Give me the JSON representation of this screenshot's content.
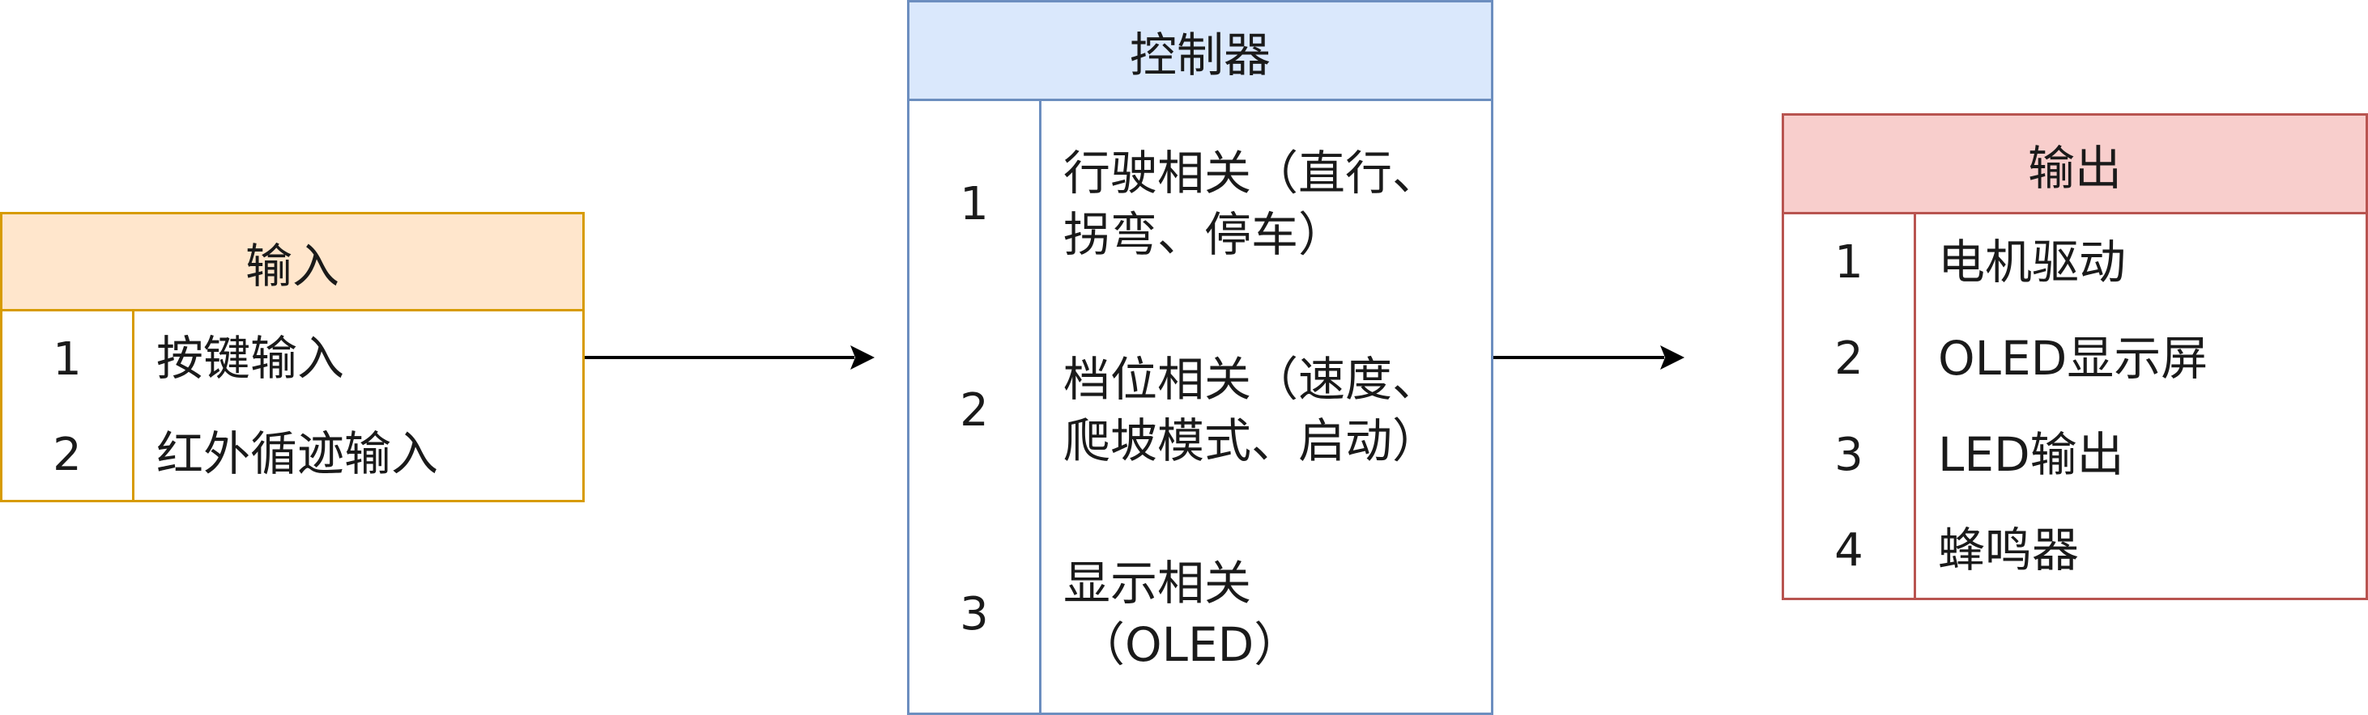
{
  "input": {
    "title": "输入",
    "items": [
      {
        "num": "1",
        "text": "按键输入"
      },
      {
        "num": "2",
        "text": "红外循迹输入"
      }
    ]
  },
  "controller": {
    "title": "控制器",
    "items": [
      {
        "num": "1",
        "line1": "行驶相关（直行、",
        "line2": "拐弯、停车）"
      },
      {
        "num": "2",
        "line1": "档位相关（速度、",
        "line2": "爬坡模式、启动）"
      },
      {
        "num": "3",
        "line1": "显示相关",
        "line2": "（OLED）"
      }
    ]
  },
  "output": {
    "title": "输出",
    "items": [
      {
        "num": "1",
        "text": "电机驱动"
      },
      {
        "num": "2",
        "text": "OLED显示屏"
      },
      {
        "num": "3",
        "text": "LED输出"
      },
      {
        "num": "4",
        "text": "蜂鸣器"
      }
    ]
  },
  "colors": {
    "input_border": "#d79b00",
    "input_fill": "#ffe6cc",
    "controller_border": "#6c8ebf",
    "controller_fill": "#dae8fc",
    "output_border": "#b85450",
    "output_fill": "#f8cecc",
    "arrow": "#000000"
  }
}
